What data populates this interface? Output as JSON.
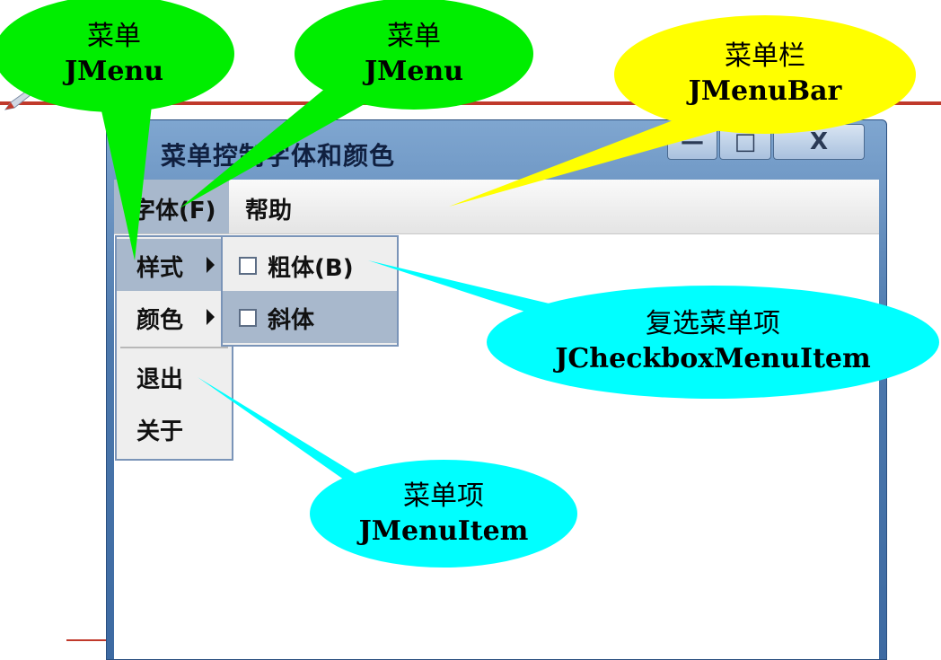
{
  "window": {
    "title": "菜单控制字体和颜色",
    "minimize_glyph": "—",
    "maximize_glyph": "□",
    "close_glyph": "X"
  },
  "menubar": {
    "menus": [
      {
        "label": "字体(F)"
      },
      {
        "label": "帮助"
      }
    ]
  },
  "font_menu": {
    "items": [
      {
        "label": "样式"
      },
      {
        "label": "颜色"
      },
      {
        "label": "退出"
      },
      {
        "label": "关于"
      }
    ]
  },
  "style_submenu": {
    "items": [
      {
        "label": "粗体(B)",
        "checked": false
      },
      {
        "label": "斜体",
        "checked": false
      }
    ]
  },
  "callouts": {
    "menu1": {
      "cn": "菜单",
      "en": "JMenu"
    },
    "menu2": {
      "cn": "菜单",
      "en": "JMenu"
    },
    "menubar": {
      "cn": "菜单栏",
      "en": "JMenuBar"
    },
    "checkbox_item": {
      "cn": "复选菜单项",
      "en": "JCheckboxMenuItem"
    },
    "menu_item": {
      "cn": "菜单项",
      "en": "JMenuItem"
    }
  },
  "colors": {
    "callout_green": "#00ee00",
    "callout_yellow": "#ffff00",
    "callout_cyan": "#00ffff",
    "selection": "#a8b8cc"
  }
}
